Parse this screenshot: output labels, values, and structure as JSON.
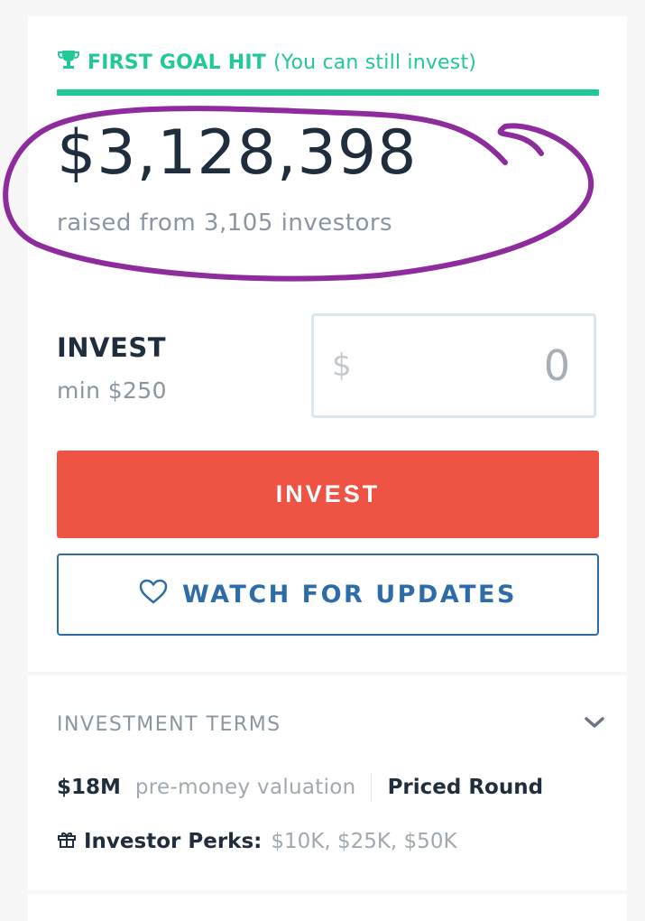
{
  "goal": {
    "title": "FIRST GOAL HIT",
    "subtitle": "(You can still invest)",
    "accent_color": "#20c997",
    "icon": "trophy-icon"
  },
  "raise": {
    "amount": "$3,128,398",
    "caption": "raised from 3,105 investors",
    "annotation_color": "#8e2c9e"
  },
  "invest": {
    "label": "INVEST",
    "minimum": "min $250",
    "currency_symbol": "$",
    "amount_value": "0",
    "button_label": "INVEST",
    "button_color": "#ef5343"
  },
  "watch": {
    "label": "WATCH FOR UPDATES",
    "icon": "heart-icon",
    "color": "#2d6ca8"
  },
  "terms": {
    "title": "INVESTMENT TERMS",
    "valuation_amount": "$18M",
    "valuation_label": "pre-money valuation",
    "round_type": "Priced Round",
    "perks_label": "Investor Perks:",
    "perks_values": "$10K, $25K, $50K"
  }
}
